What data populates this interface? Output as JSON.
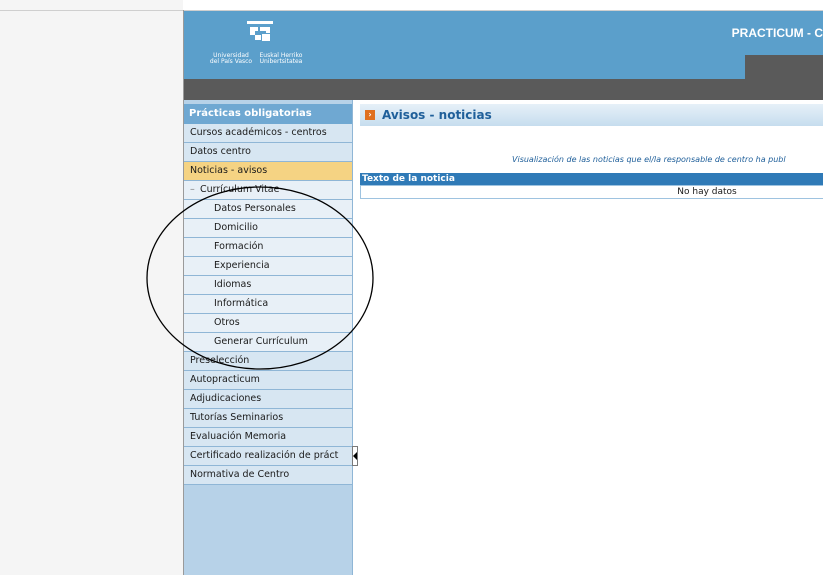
{
  "header": {
    "logo_text_es": "Universidad del País Vasco",
    "logo_text_eu": "Euskal Herriko Unibertsitatea",
    "app_title": "PRACTICUM - C"
  },
  "sidebar": {
    "section_title": "Prácticas obligatorias",
    "items": [
      {
        "label": "Cursos académicos - centros",
        "type": "item"
      },
      {
        "label": "Datos centro",
        "type": "item"
      },
      {
        "label": "Noticias - avisos",
        "type": "active"
      },
      {
        "label": "Currículum Vitae",
        "type": "cv"
      },
      {
        "label": "Datos Personales",
        "type": "sub"
      },
      {
        "label": "Domicilio",
        "type": "sub"
      },
      {
        "label": "Formación",
        "type": "sub"
      },
      {
        "label": "Experiencia",
        "type": "sub"
      },
      {
        "label": "Idiomas",
        "type": "sub"
      },
      {
        "label": "Informática",
        "type": "sub"
      },
      {
        "label": "Otros",
        "type": "sub"
      },
      {
        "label": "Generar Currículum",
        "type": "sub"
      },
      {
        "label": "Preselección",
        "type": "item"
      },
      {
        "label": "Autopracticum",
        "type": "item"
      },
      {
        "label": "Adjudicaciones",
        "type": "item"
      },
      {
        "label": "Tutorías Seminarios",
        "type": "item"
      },
      {
        "label": "Evaluación Memoria",
        "type": "item"
      },
      {
        "label": "Certificado realización de práct",
        "type": "item"
      },
      {
        "label": "Normativa de Centro",
        "type": "item"
      }
    ]
  },
  "content": {
    "title": "Avisos - noticias",
    "caption": "Visualización de las noticias que el/la responsable de centro ha publ",
    "table_header": "Texto de la noticia",
    "empty_text": "No hay datos"
  },
  "colors": {
    "header_blue": "#5b9fcb",
    "active_item": "#f5d383",
    "table_header": "#2f7ab7"
  }
}
